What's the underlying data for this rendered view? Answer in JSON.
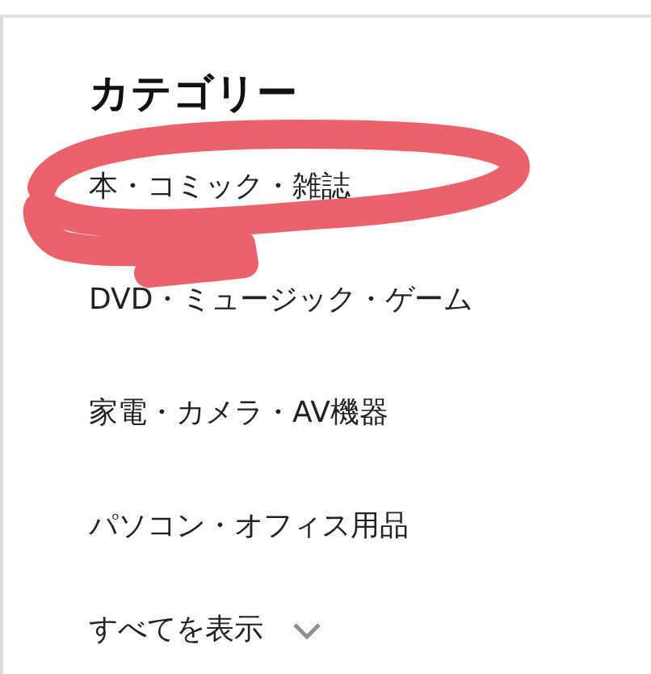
{
  "heading": "カテゴリー",
  "items": [
    {
      "label": "本・コミック・雑誌"
    },
    {
      "label": "DVD・ミュージック・ゲーム"
    },
    {
      "label": "家電・カメラ・AV機器"
    },
    {
      "label": "パソコン・オフィス用品"
    }
  ],
  "show_all": {
    "label": "すべてを表示"
  },
  "annotation": {
    "kind": "scribble"
  }
}
